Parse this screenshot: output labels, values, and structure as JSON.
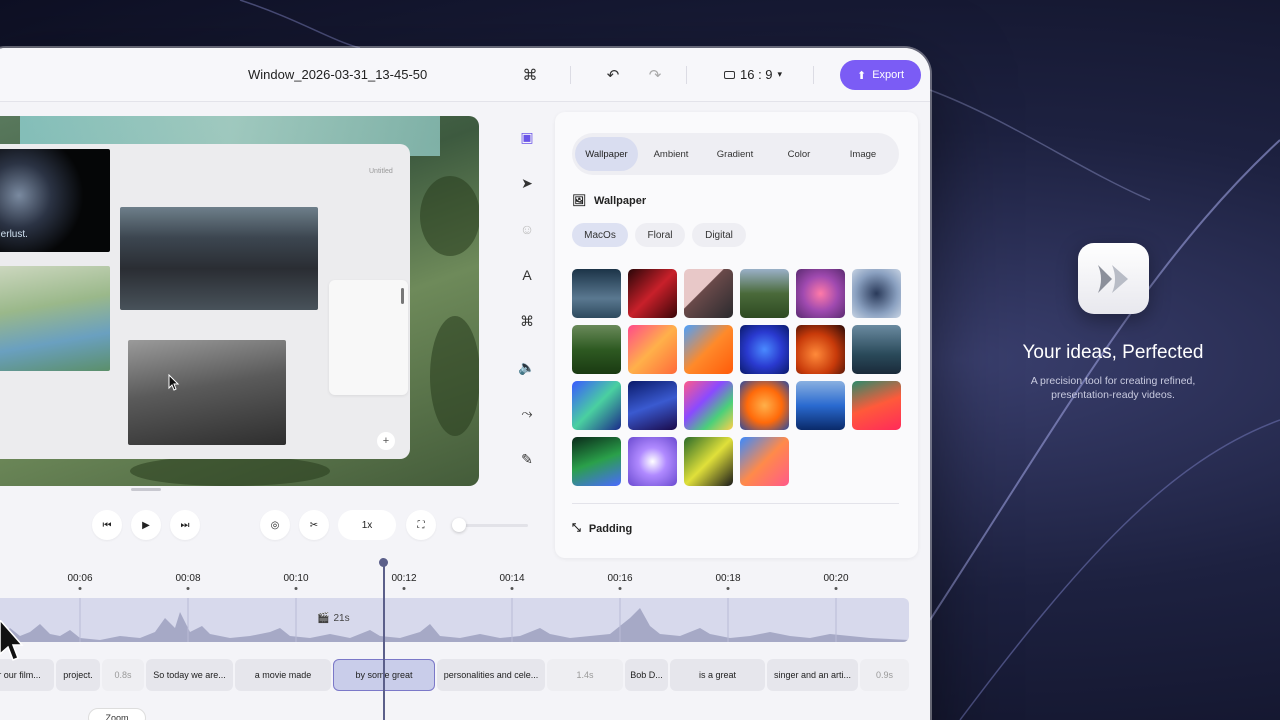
{
  "window_title": "Window_2026-03-31_13-45-50",
  "toolbar": {
    "command_icon": "command-icon",
    "undo_icon": "undo-icon",
    "redo_icon": "redo-icon",
    "aspect_label": "16 : 9",
    "export_label": "Export"
  },
  "canvas": {
    "untitled_label": "Untitled",
    "apple_caption": "onderlust.",
    "plus_label": "+"
  },
  "tools": [
    "crop-icon",
    "cursor-icon",
    "smiley-icon",
    "text-icon",
    "command-icon",
    "volume-icon",
    "path-icon",
    "annotate-icon"
  ],
  "panel": {
    "tabs": [
      {
        "label": "Wallpaper",
        "active": true
      },
      {
        "label": "Ambient",
        "active": false
      },
      {
        "label": "Gradient",
        "active": false
      },
      {
        "label": "Color",
        "active": false
      },
      {
        "label": "Image",
        "active": false
      }
    ],
    "section_title": "Wallpaper",
    "chips": [
      {
        "label": "MacOs",
        "active": true
      },
      {
        "label": "Floral",
        "active": false
      },
      {
        "label": "Digital",
        "active": false
      }
    ],
    "padding_title": "Padding"
  },
  "playback": {
    "speed_label": "1x"
  },
  "timeline": {
    "ticks": [
      "00:06",
      "00:08",
      "00:10",
      "00:12",
      "00:14",
      "00:16",
      "00:18",
      "00:20"
    ],
    "clip_duration": "21s",
    "captions": [
      {
        "text": "or our film...",
        "type": "caption"
      },
      {
        "text": "project.",
        "type": "caption"
      },
      {
        "text": "0.8s",
        "type": "gap"
      },
      {
        "text": "So today we are...",
        "type": "caption"
      },
      {
        "text": "a movie made",
        "type": "caption"
      },
      {
        "text": "by some great",
        "type": "selected"
      },
      {
        "text": "personalities and cele...",
        "type": "caption"
      },
      {
        "text": "1.4s",
        "type": "gap"
      },
      {
        "text": "Bob D...",
        "type": "caption"
      },
      {
        "text": "is a great",
        "type": "caption"
      },
      {
        "text": "singer and an arti...",
        "type": "caption"
      },
      {
        "text": "0.9s",
        "type": "gap"
      }
    ],
    "zoom_label": "Zoom"
  },
  "branding": {
    "tagline": "Your ideas, Perfected",
    "subline": "A precision tool for creating refined, presentation-ready videos."
  },
  "colors": {
    "accent": "#7b5cf5",
    "track": "#d7d9ec",
    "selected_caption": "#c9cdea"
  }
}
